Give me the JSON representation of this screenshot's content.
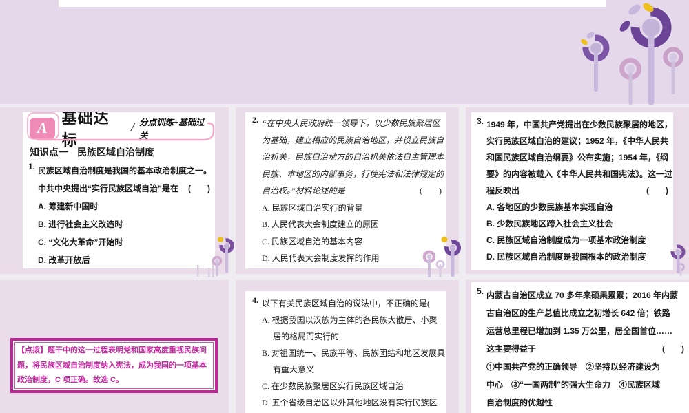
{
  "colors": {
    "accent_magenta": "#c42b9e",
    "badge_pink": "#f08ab6",
    "curve_pink": "#f3a8c8",
    "dark_purple": "#6b4397",
    "mid_purple": "#7d55a6",
    "light_purple": "#c9b8dd",
    "pink_ring": "#cda5cb",
    "leaf_yellow": "#eec01d",
    "bg_top": "#e4d8ea",
    "bg_cell": "#ebdcea",
    "bg_gutter": "#efecf2"
  },
  "decor": {
    "top_right": "flower-cluster",
    "left_gap": "small-flowers",
    "middle_gap": "small-flowers",
    "right_edge": "small-flower"
  },
  "header": {
    "badge": "A",
    "title": "基础达标",
    "slash": "/",
    "subtitle": "分点训练+基础过关"
  },
  "knowledge_point": {
    "label": "知识点一",
    "title": "民族区域自治制度"
  },
  "bracket": "(　　)",
  "q1": {
    "num": "1.",
    "stem": [
      "民族区域自治制度是我国的基本政治制度之一。",
      "中共中央提出“实行民族区域自治”是在"
    ],
    "options": [
      "A. 筹建新中国时",
      "B. 进行社会主义改造时",
      "C. “文化大革命”开始时",
      "D. 改革开放后"
    ]
  },
  "q2": {
    "num": "2.",
    "stem": [
      "“在中央人民政府统一领导下，以少数民族聚居区",
      "为基础，建立相应的民族自治地区，并设立民族自",
      "治机关，民族自治地方的自治机关依法自主管理本",
      "民族、本地区的内部事务，行使宪法和法律规定的",
      "自治权。”材料论述的是"
    ],
    "options": [
      "A. 民族区域自治实行的背景",
      "B. 人民代表大会制度建立的原因",
      "C. 民族区域自治的基本内容",
      "D. 人民代表大会制度发挥的作用"
    ]
  },
  "q3": {
    "num": "3.",
    "stem": [
      "1949 年，中国共产党提出在少数民族聚居的地区，",
      "实行民族区域自治的建议；1952 年，《中华人民共",
      "和国民族区域自治纲要》公布实施；1954 年，《纲",
      "要》的内容被载入《中华人民共和国宪法》。这一过",
      "程反映出"
    ],
    "options": [
      "A. 各地区的少数民族基本实现自治",
      "B. 少数民族地区跨入社会主义社会",
      "C. 民族区域自治制度成为一项基本政治制度",
      "D. 民族区域自治制度是我国根本的政治制度"
    ]
  },
  "q4": {
    "num": "4.",
    "stem": [
      "以下有关民族区域自治的说法中，不正确的是"
    ],
    "options": [
      [
        "A. 根据我国以汉族为主体的各民族大散居、小聚",
        "居的格局而实行的"
      ],
      [
        "B. 对祖国统一、民族平等、民族团结和地区发展具",
        "有重大意义"
      ],
      [
        "C. 在少数民族聚居区实行民族区域自治"
      ],
      [
        "D. 五个省级自治区以外其他地区没有实行民族区"
      ]
    ]
  },
  "q5": {
    "num": "5.",
    "stem": [
      "内蒙古自治区成立 70 多年来硕果累累；2016 年内蒙",
      "古自治区的生产总值比成立之初增长 642 倍；铁路",
      "运营总里程已增加到 1.35 万公里，居全国首位……",
      "这主要得益于"
    ],
    "options": [
      "①中国共产党的正确领导　②坚持以经济建设为",
      "中心　③“一国两制”的强大生命力　④民族区域",
      "自治制度的优越性"
    ]
  },
  "hint": {
    "lines": [
      "【点拨】题干中的这一过程表明党和国家高度重视民族问",
      "题，将民族区域自治制度纳入宪法，成为我国的一项基本",
      "政治制度，C 项正确。故选 C。"
    ]
  }
}
